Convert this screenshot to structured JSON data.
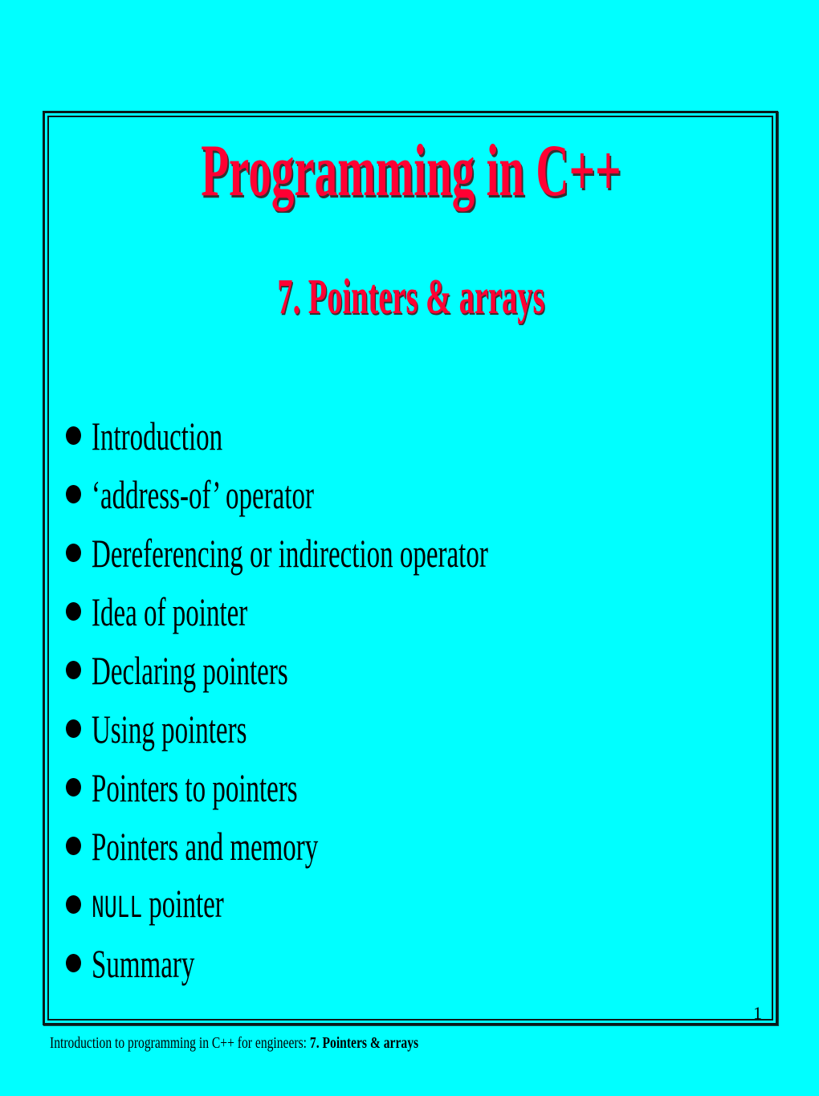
{
  "slide": {
    "title": "Programming in C++",
    "subtitle": "7. Pointers & arrays",
    "bullets": [
      {
        "code": "",
        "text": "Introduction"
      },
      {
        "code": "",
        "text": "‘address-of’ operator"
      },
      {
        "code": "",
        "text": "Dereferencing or indirection operator"
      },
      {
        "code": "",
        "text": "Idea of pointer"
      },
      {
        "code": "",
        "text": "Declaring pointers"
      },
      {
        "code": "",
        "text": "Using pointers"
      },
      {
        "code": "",
        "text": "Pointers to pointers"
      },
      {
        "code": "",
        "text": "Pointers and memory"
      },
      {
        "code": "NULL",
        "text": "pointer"
      },
      {
        "code": "",
        "text": "Summary"
      }
    ],
    "page_number": "1"
  },
  "footer": {
    "course": "Introduction to programming in C++ for engineers: ",
    "chapter": "7. Pointers & arrays"
  },
  "colors": {
    "background": "#00ffff",
    "title": "#ff0033",
    "text": "#000000"
  }
}
